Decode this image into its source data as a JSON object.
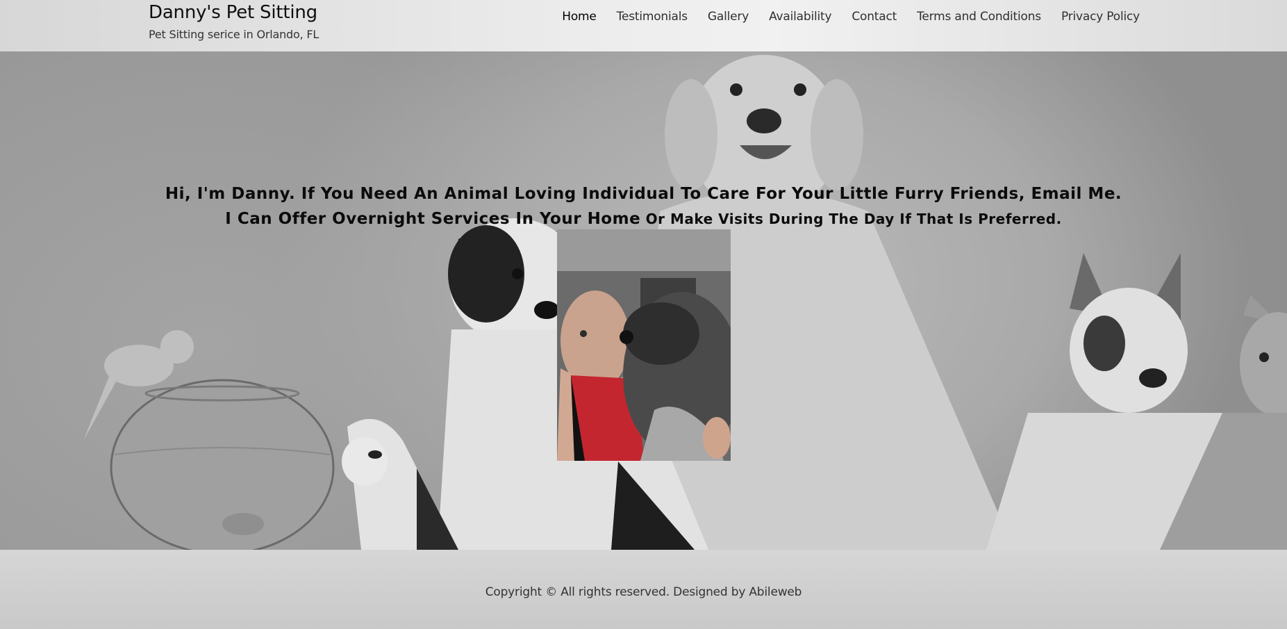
{
  "header": {
    "site_title": "Danny's Pet Sitting",
    "tagline": "Pet Sitting serice in Orlando, FL"
  },
  "nav": {
    "items": [
      {
        "label": "Home",
        "active": true
      },
      {
        "label": "Testimonials"
      },
      {
        "label": "Gallery"
      },
      {
        "label": "Availability"
      },
      {
        "label": "Contact"
      },
      {
        "label": "Terms and Conditions"
      },
      {
        "label": "Privacy Policy"
      }
    ]
  },
  "hero": {
    "line1": "Hi, I'm Danny. If You Need An Animal  Loving Individual To Care For Your Little Furry Friends, Email Me.",
    "line2_main": "I Can Offer Overnight Services In Your Home",
    "line2_small": " Or Make Visits During The Day If That Is Preferred."
  },
  "footer": {
    "copyright": "Copyright © All rights reserved. Designed by Abileweb"
  },
  "colors": {
    "header_bg": "#ececec",
    "hero_bg": "#a8a8a8",
    "footer_bg": "#cfcfcf",
    "text": "#111111",
    "shirt_red": "#c4262f"
  }
}
